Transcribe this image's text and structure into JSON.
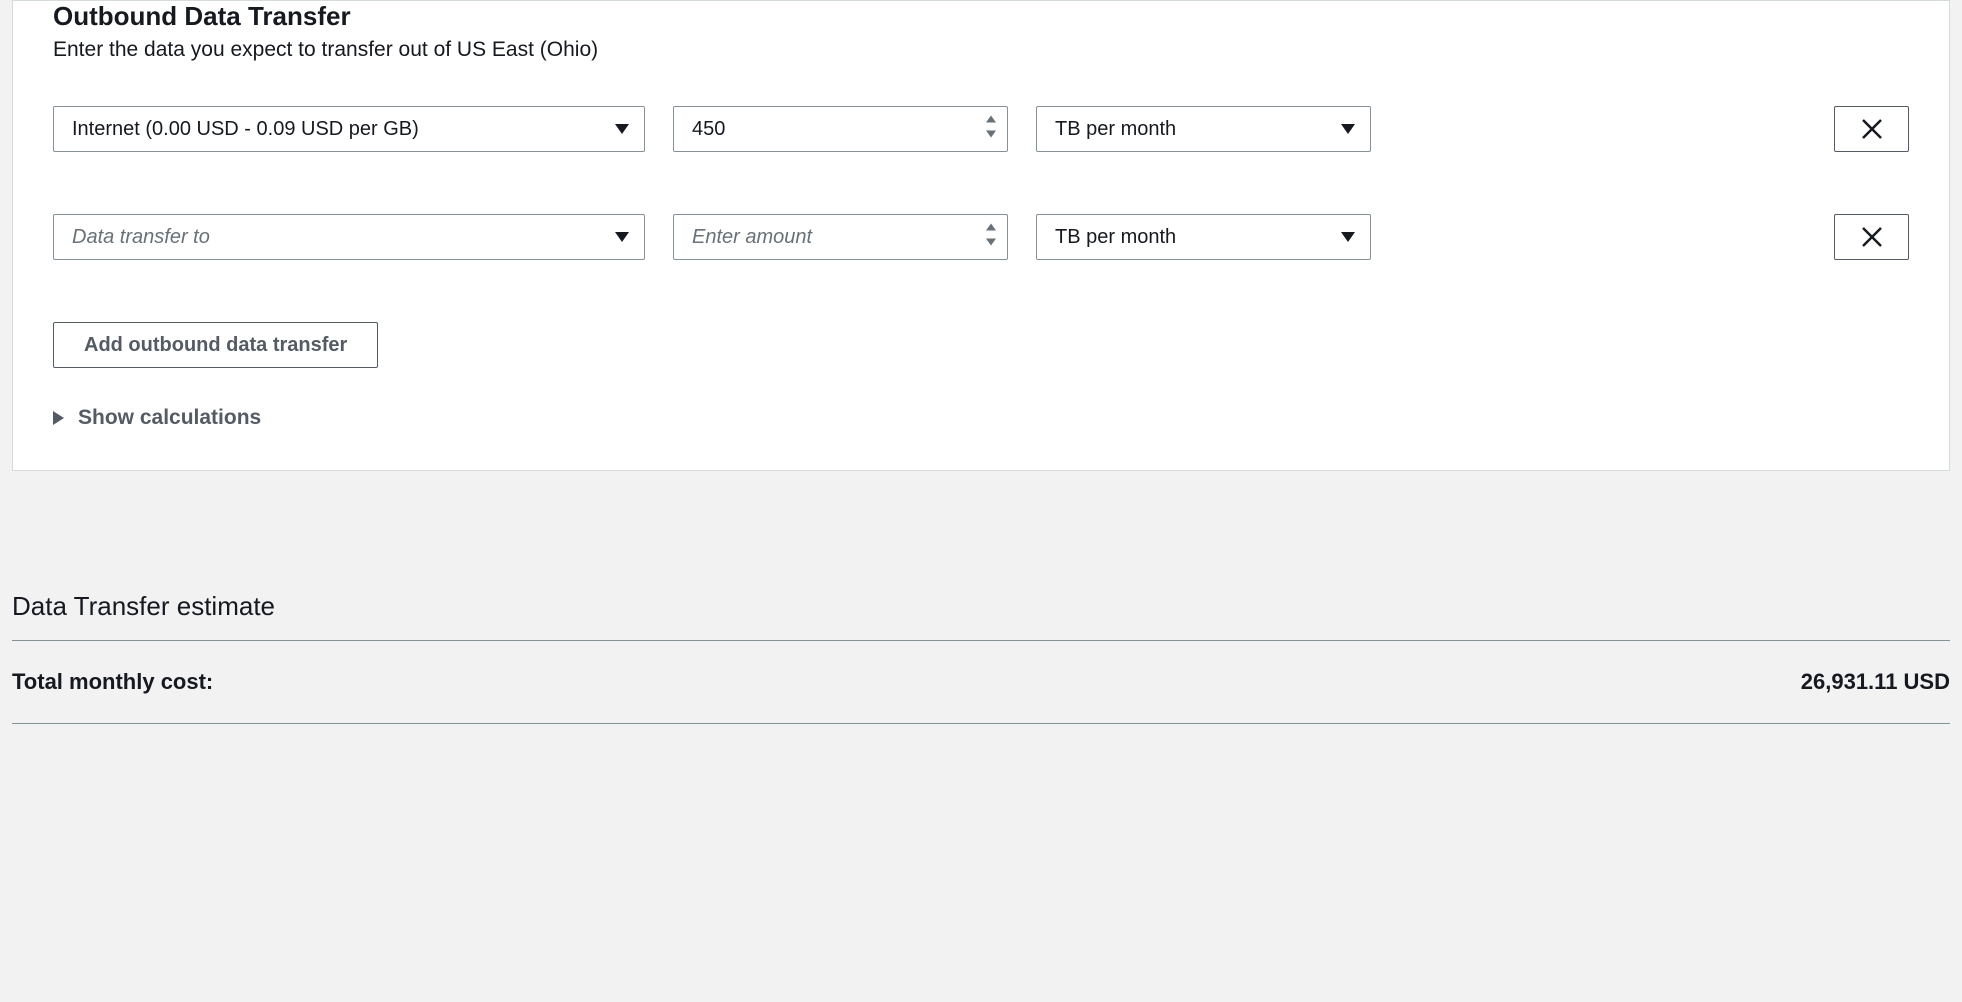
{
  "outbound": {
    "title": "Outbound Data Transfer",
    "subtitle": "Enter the data you expect to transfer out of US East (Ohio)",
    "rows": [
      {
        "destination": "Internet (0.00 USD - 0.09 USD per GB)",
        "destination_placeholder": "",
        "amount": "450",
        "amount_placeholder": "Enter amount",
        "unit": "TB per month"
      },
      {
        "destination": "",
        "destination_placeholder": "Data transfer to",
        "amount": "",
        "amount_placeholder": "Enter amount",
        "unit": "TB per month"
      }
    ],
    "add_button_label": "Add outbound data transfer",
    "show_calculations_label": "Show calculations"
  },
  "estimate": {
    "title": "Data Transfer estimate",
    "total_label": "Total monthly cost:",
    "total_value": "26,931.11 USD"
  }
}
